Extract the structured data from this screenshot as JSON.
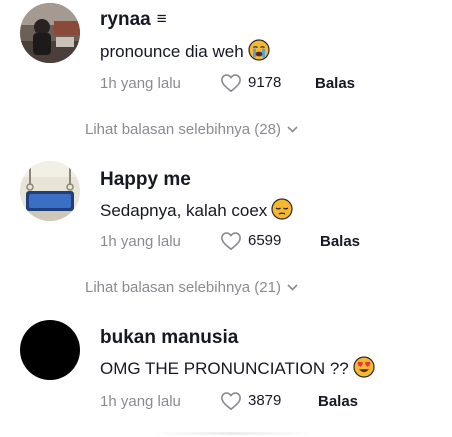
{
  "comments": [
    {
      "username": "rynaa",
      "username_icon": "menu-lines-icon",
      "text": "pronounce dia weh",
      "emoji": "crying-face-emoji",
      "time": "1h yang lalu",
      "likes": "9178",
      "reply": "Balas",
      "more_replies": "Lihat balasan selebihnya (28)"
    },
    {
      "username": "Happy me",
      "text": "Sedapnya, kalah coex",
      "emoji": "pensive-face-emoji",
      "time": "1h yang lalu",
      "likes": "6599",
      "reply": "Balas",
      "more_replies": "Lihat balasan selebihnya (21)"
    },
    {
      "username": "bukan manusia",
      "text": "OMG THE PRONUNCIATION ??",
      "emoji": "heart-eyes-emoji",
      "time": "1h yang lalu",
      "likes": "3879",
      "reply": "Balas"
    }
  ],
  "colors": {
    "text_primary": "#161823",
    "text_secondary": "#8a8b91",
    "emoji_yellow": "#f7b731",
    "heart_red": "#e8343e"
  }
}
